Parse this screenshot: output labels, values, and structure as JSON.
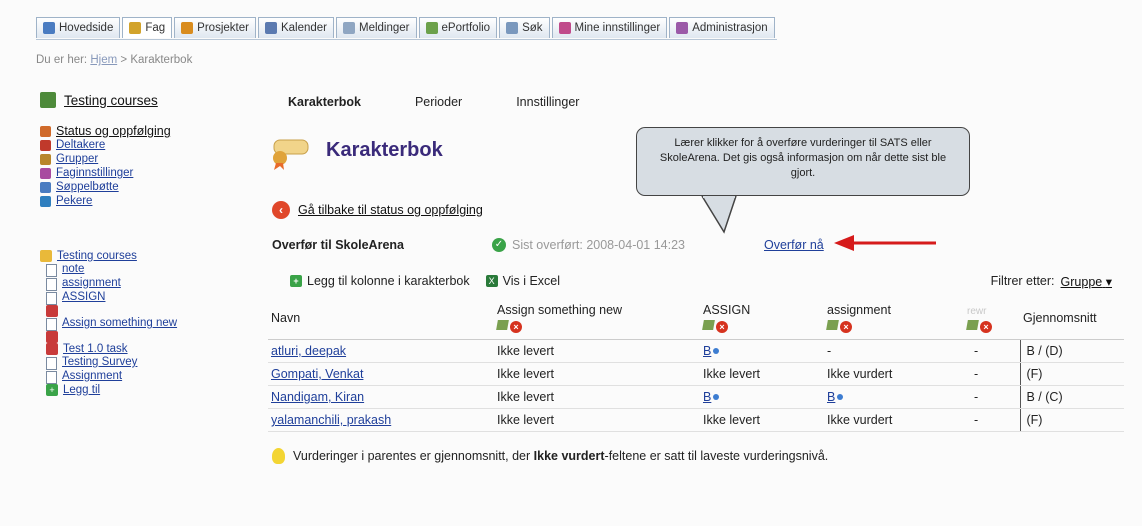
{
  "topnav": {
    "tabs": [
      {
        "label": "Hovedside",
        "icon": "home-icon",
        "color": "#4a7cc1"
      },
      {
        "label": "Fag",
        "icon": "subjects-icon",
        "color": "#d2a32b"
      },
      {
        "label": "Prosjekter",
        "icon": "projects-icon",
        "color": "#d98c1e"
      },
      {
        "label": "Kalender",
        "icon": "calendar-icon",
        "color": "#5b7ab0"
      },
      {
        "label": "Meldinger",
        "icon": "messages-icon",
        "color": "#8fa6c2"
      },
      {
        "label": "ePortfolio",
        "icon": "eportfolio-icon",
        "color": "#6ca14b"
      },
      {
        "label": "Søk",
        "icon": "search-icon",
        "color": "#7a98bd"
      },
      {
        "label": "Mine innstillinger",
        "icon": "settings-icon",
        "color": "#c04b8b"
      },
      {
        "label": "Administrasjon",
        "icon": "admin-icon",
        "color": "#9b5aa8"
      }
    ]
  },
  "breadcrumb": {
    "prefix": "Du er her:",
    "home": "Hjem",
    "sep": ">",
    "current": "Karakterbok"
  },
  "sidebar": {
    "course_title": "Testing courses",
    "links": [
      {
        "label": "Status og oppfølging",
        "icon": "status-icon",
        "color": "#d06a2a"
      },
      {
        "label": "Deltakere",
        "icon": "participants-icon",
        "color": "#c0392b"
      },
      {
        "label": "Grupper",
        "icon": "groups-icon",
        "color": "#b8862b"
      },
      {
        "label": "Faginnstillinger",
        "icon": "course-settings-icon",
        "color": "#a84aa0"
      },
      {
        "label": "Søppelbøtte",
        "icon": "trash-icon",
        "color": "#4a7cc1"
      },
      {
        "label": "Pekere",
        "icon": "globe-icon",
        "color": "#2f7fbf"
      }
    ],
    "tree_root": "Testing courses",
    "tree_items": [
      "note",
      "assignment",
      "ASSIGN",
      "",
      "Assign something new",
      "",
      "Test 1.0 task",
      "Testing Survey",
      "Assignment",
      "Legg til"
    ]
  },
  "subnav": {
    "tabs": [
      "Karakterbok",
      "Perioder",
      "Innstillinger"
    ]
  },
  "page": {
    "title": "Karakterbok",
    "back_link": "Gå tilbake til status og oppfølging",
    "transfer_label": "Overfør til SkoleArena",
    "last_transfer": "Sist overført: 2008-04-01 14:23",
    "transfer_now": "Overfør nå",
    "callout": "Lærer klikker for å overføre vurderinger til SATS eller SkoleArena. Det gis også informasjon om når dette sist ble gjort.",
    "add_column": "Legg til kolonne i karakterbok",
    "view_excel": "Vis i Excel",
    "filter_label": "Filtrer etter:",
    "filter_value": "Gruppe",
    "note_text": "Vurderinger i parentes er gjennomsnitt, der",
    "note_bold": "Ikke vurdert",
    "note_text2": "-feltene er satt til laveste vurderingsnivå."
  },
  "table": {
    "headers": [
      "Navn",
      "Assign something new",
      "ASSIGN",
      "assignment",
      "rewr",
      "Gjennomsnitt"
    ],
    "rows": [
      [
        "atluri, deepak",
        "Ikke levert",
        "B",
        "-",
        "-",
        "B / (D)"
      ],
      [
        "Gompati, Venkat",
        "Ikke levert",
        "Ikke levert",
        "Ikke vurdert",
        "-",
        "(F)"
      ],
      [
        "Nandigam, Kiran",
        "Ikke levert",
        "B",
        "B",
        "-",
        "B / (C)"
      ],
      [
        "yalamanchili, prakash",
        "Ikke levert",
        "Ikke levert",
        "Ikke vurdert",
        "-",
        "(F)"
      ]
    ]
  }
}
